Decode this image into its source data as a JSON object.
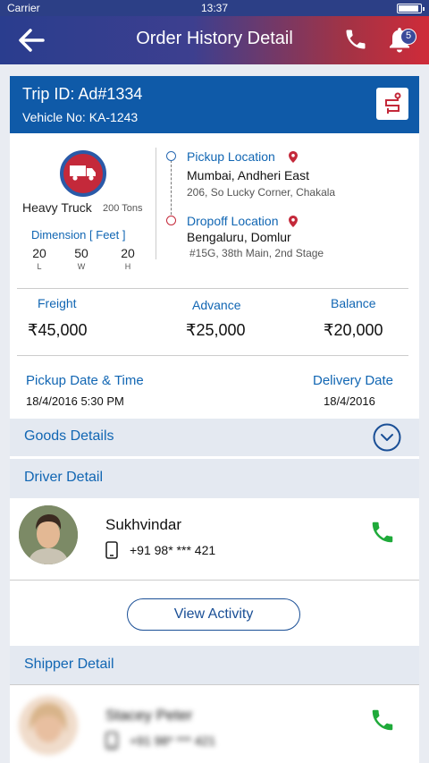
{
  "status_bar": {
    "carrier": "Carrier",
    "time": "13:37"
  },
  "app_bar": {
    "title": "Order History Detail",
    "notification_count": "5"
  },
  "trip": {
    "trip_id": "Trip ID:  Ad#1334",
    "vehicle_no": "Vehicle No:  KA-1243"
  },
  "truck": {
    "type": "Heavy Truck",
    "capacity": "200 Tons",
    "dimension_label": "Dimension [ Feet ]",
    "dimensions": [
      {
        "value": "20",
        "key": "L"
      },
      {
        "value": "50",
        "key": "W"
      },
      {
        "value": "20",
        "key": "H"
      }
    ]
  },
  "pickup": {
    "label": "Pickup Location",
    "city": "Mumbai, Andheri East",
    "address": "206, So Lucky Corner, Chakala"
  },
  "dropoff": {
    "label": "Dropoff Location",
    "city": "Bengaluru, Domlur",
    "address": "#15G, 38th Main, 2nd Stage"
  },
  "amounts": {
    "freight_label": "Freight",
    "freight": "₹45,000",
    "advance_label": "Advance",
    "advance": "₹25,000",
    "balance_label": "Balance",
    "balance": "₹20,000"
  },
  "dates": {
    "pickup_label": "Pickup Date & Time",
    "pickup": "18/4/2016 5:30 PM",
    "delivery_label": "Delivery Date",
    "delivery": "18/4/2016"
  },
  "goods": {
    "label": "Goods Details"
  },
  "driver": {
    "section": "Driver Detail",
    "name": "Sukhvindar",
    "phone": "+91 98* *** 421"
  },
  "view_activity": "View Activity",
  "shipper": {
    "section": "Shipper Detail",
    "name": "Stacey Peter",
    "phone": "+91 98* *** 421"
  },
  "colors": {
    "primary_blue": "#1166b3",
    "header_blue": "#0f5aa8",
    "accent_red": "#c4293a",
    "call_green": "#1faa3a"
  }
}
